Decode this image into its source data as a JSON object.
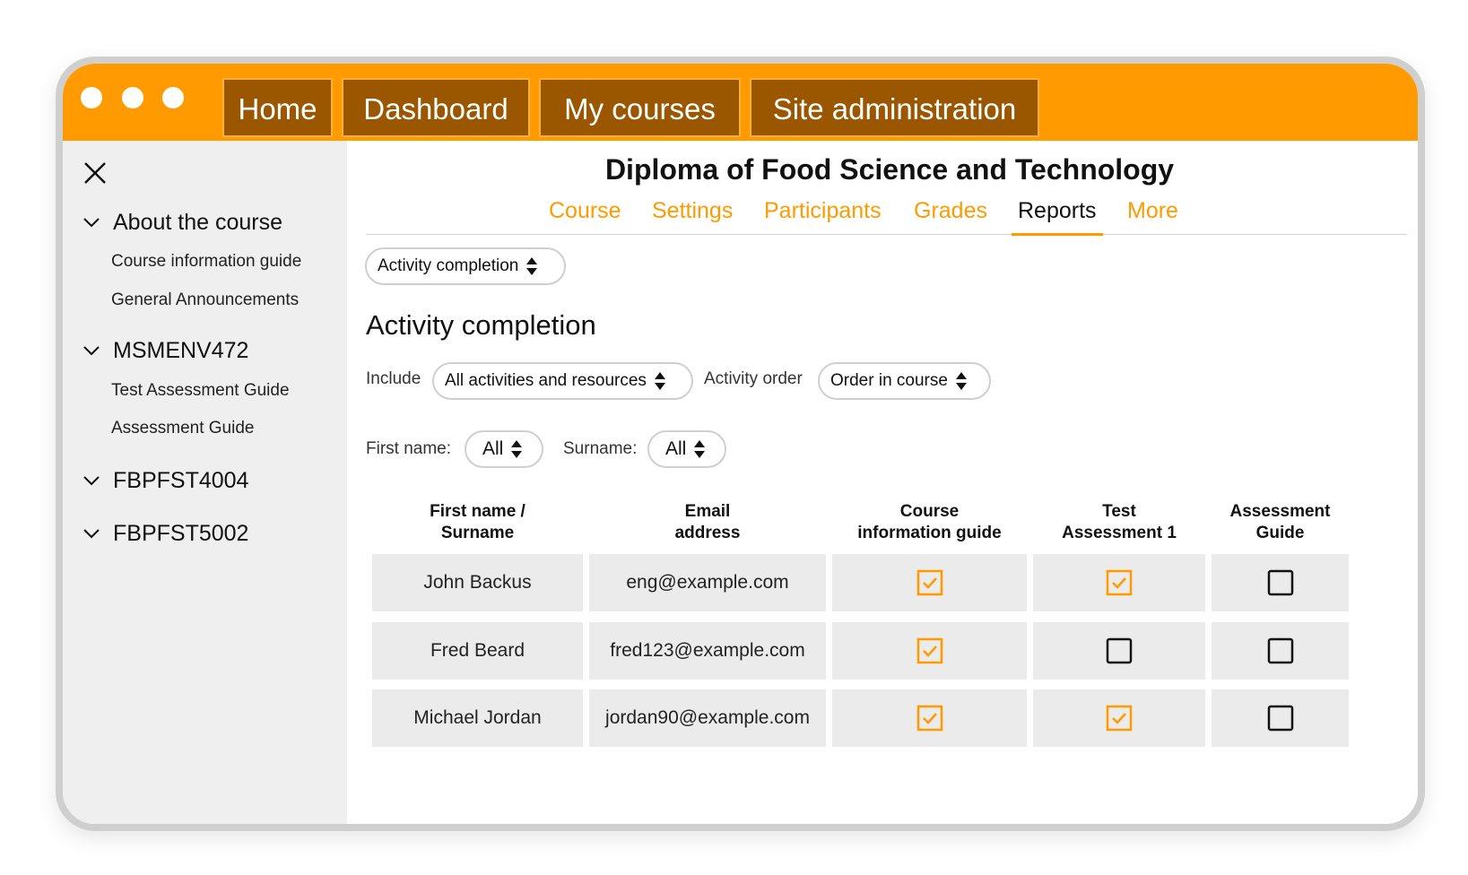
{
  "colors": {
    "accent": "#ff9b00",
    "nav_bg": "#9a5700",
    "sidebar_bg": "#efefef",
    "cell_bg": "#ebebeb"
  },
  "topnav": {
    "window_controls": [
      "dot",
      "dot",
      "dot"
    ],
    "items": [
      "Home",
      "Dashboard",
      "My courses",
      "Site administration"
    ]
  },
  "sidebar": {
    "close_icon": "close-icon",
    "sections": [
      {
        "label": "About the course",
        "items": [
          "Course information guide",
          "General Announcements"
        ]
      },
      {
        "label": "MSMENV472",
        "items": [
          "Test Assessment Guide",
          "Assessment Guide"
        ]
      },
      {
        "label": "FBPFST4004",
        "items": []
      },
      {
        "label": "FBPFST5002",
        "items": []
      }
    ]
  },
  "main": {
    "course_title": "Diploma of Food Science and Technology",
    "tabs": [
      "Course",
      "Settings",
      "Participants",
      "Grades",
      "Reports",
      "More"
    ],
    "active_tab": "Reports",
    "report_select": "Activity completion",
    "heading": "Activity completion",
    "filters": {
      "include_label": "Include",
      "include_value": "All activities and resources",
      "order_label": "Activity order",
      "order_value": "Order in course",
      "firstname_label": "First name:",
      "firstname_value": "All",
      "surname_label": "Surname:",
      "surname_value": "All"
    },
    "table": {
      "headers": [
        [
          "First name /",
          "Surname"
        ],
        [
          "Email",
          "address"
        ],
        [
          "Course",
          "information guide"
        ],
        [
          "Test",
          "Assessment 1"
        ],
        [
          "Assessment",
          "Guide"
        ]
      ],
      "rows": [
        {
          "name": "John Backus",
          "email": "eng@example.com",
          "completion": [
            true,
            true,
            false
          ]
        },
        {
          "name": "Fred Beard",
          "email": "fred123@example.com",
          "completion": [
            true,
            false,
            false
          ]
        },
        {
          "name": "Michael Jordan",
          "email": "jordan90@example.com",
          "completion": [
            true,
            true,
            false
          ]
        }
      ]
    }
  }
}
